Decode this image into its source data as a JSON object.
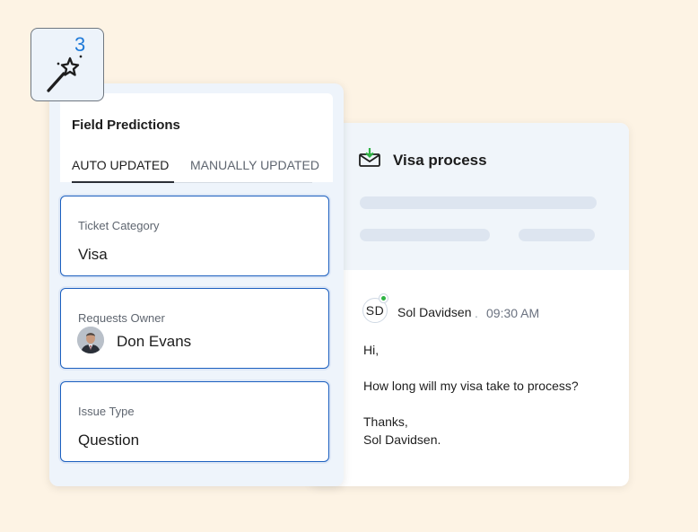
{
  "field_predictions": {
    "title": "Field Predictions",
    "tabs": [
      {
        "label": "AUTO UPDATED",
        "active": true
      },
      {
        "label": "MANUALLY UPDATED",
        "active": false
      }
    ],
    "fields": [
      {
        "label": "Ticket Category",
        "value": "Visa"
      },
      {
        "label": "Requests Owner",
        "value": "Don Evans",
        "avatar": "person-photo"
      },
      {
        "label": "Issue Type",
        "value": "Question"
      }
    ]
  },
  "wand_badge": {
    "count": "3",
    "icon": "magic-wand-icon"
  },
  "ticket": {
    "icon": "mail-incoming-icon",
    "subject": "Visa process",
    "sender": {
      "initials": "SD",
      "name": "Sol Davidsen",
      "separator": ".",
      "time": "09:30 AM"
    },
    "body": {
      "greeting": "Hi,",
      "question": "How long will my visa take to process?",
      "signoff": "Thanks,",
      "signature": "Sol Davidsen."
    }
  },
  "colors": {
    "background": "#fdf3e4",
    "accent": "#1b5fbf",
    "badge_count": "#1f7ad8",
    "mail_icon_green": "#2fb344"
  }
}
